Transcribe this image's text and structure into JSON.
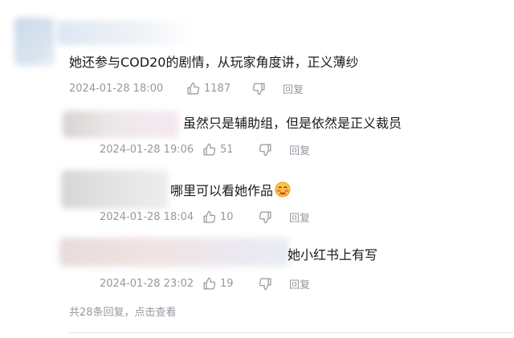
{
  "main_comment": {
    "text": "她还参与COD20的剧情，从玩家角度讲，正义薄纱",
    "time": "2024-01-28 18:00",
    "likes": "1187",
    "reply_label": "回复"
  },
  "replies": [
    {
      "text": "虽然只是辅助组，但是依然是正义裁员",
      "time": "2024-01-28 19:06",
      "likes": "51",
      "reply_label": "回复"
    },
    {
      "text": "哪里可以看她作品",
      "emoji": "blush-face-emoji",
      "time": "2024-01-28 18:04",
      "likes": "10",
      "reply_label": "回复"
    },
    {
      "text": "她小红书上有写",
      "time": "2024-01-28 23:02",
      "likes": "19",
      "reply_label": "回复"
    }
  ],
  "footer": {
    "count_text": "共28条回复，",
    "action_text": "点击查看"
  },
  "colors": {
    "text": "#18191c",
    "meta": "#9499a0",
    "divider": "#e3e5e7"
  }
}
